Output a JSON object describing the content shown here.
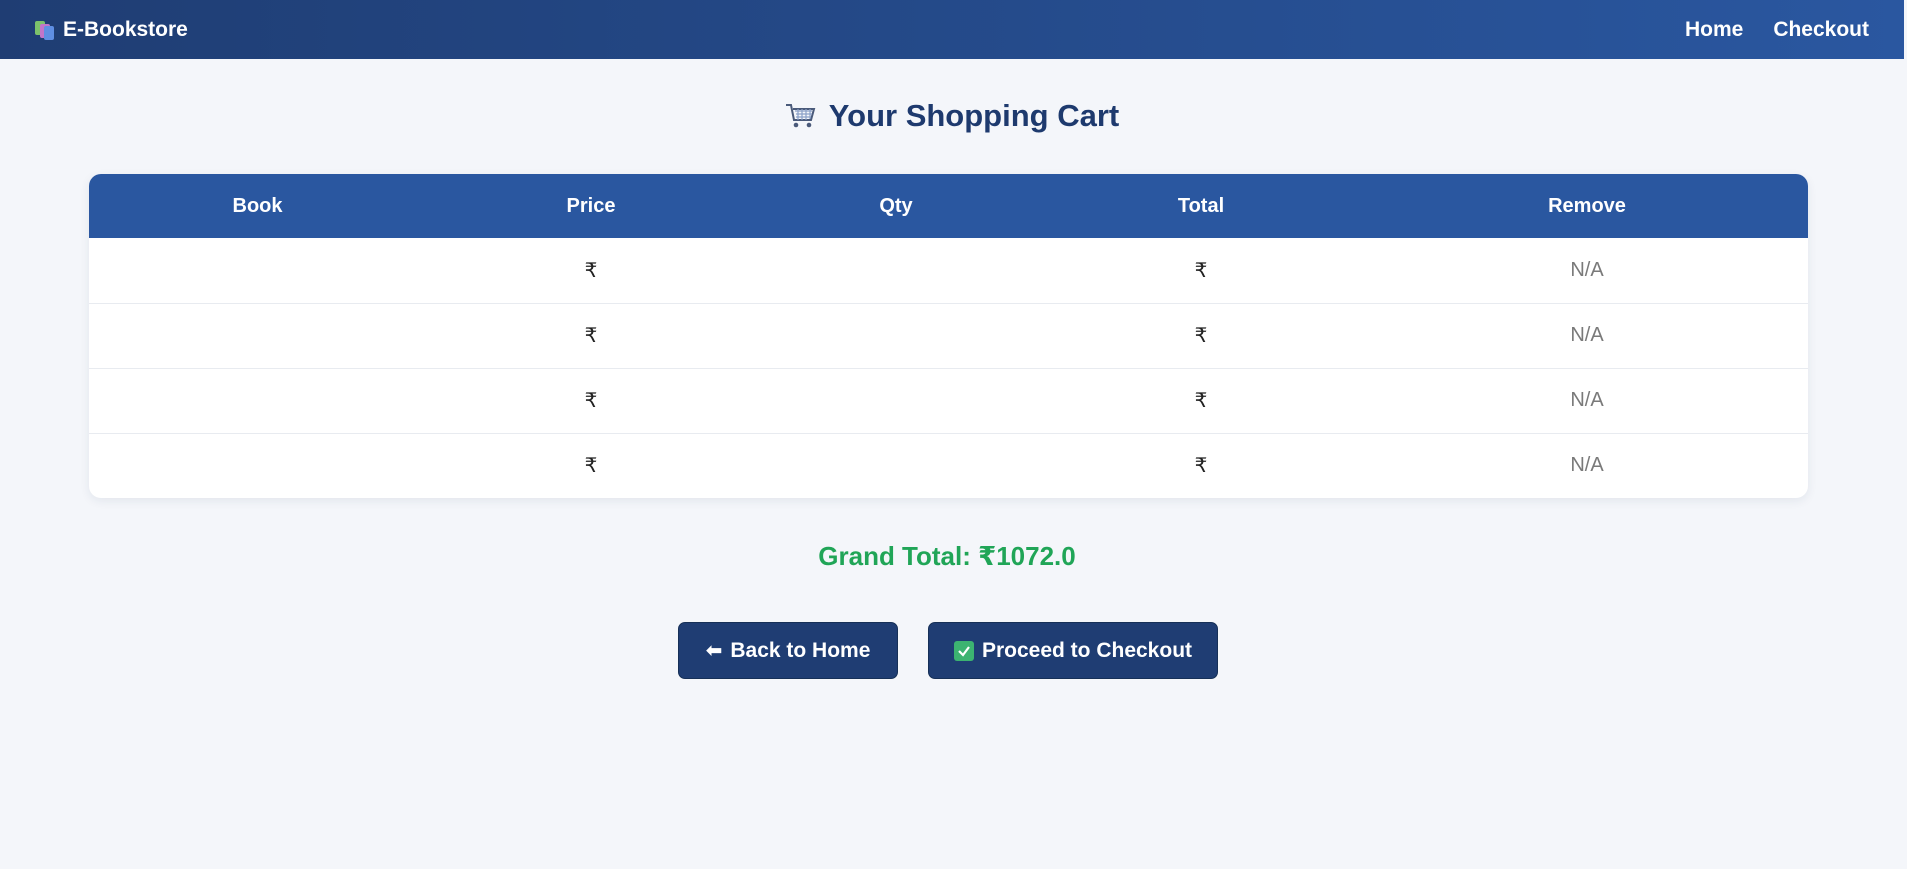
{
  "navbar": {
    "brand": "E-Bookstore",
    "links": [
      "Home",
      "Checkout"
    ]
  },
  "page": {
    "title": "Your Shopping Cart"
  },
  "cart_table": {
    "headers": [
      "Book",
      "Price",
      "Qty",
      "Total",
      "Remove"
    ],
    "rows": [
      {
        "book": "",
        "price": "₹",
        "qty": "",
        "total": "₹",
        "remove": "N/A"
      },
      {
        "book": "",
        "price": "₹",
        "qty": "",
        "total": "₹",
        "remove": "N/A"
      },
      {
        "book": "",
        "price": "₹",
        "qty": "",
        "total": "₹",
        "remove": "N/A"
      },
      {
        "book": "",
        "price": "₹",
        "qty": "",
        "total": "₹",
        "remove": "N/A"
      }
    ]
  },
  "summary": {
    "grand_total": "Grand Total: ₹1072.0"
  },
  "buttons": {
    "back_label": "Back to Home",
    "checkout_label": "Proceed to Checkout"
  },
  "colors": {
    "nav_start": "#1f3d73",
    "nav_end": "#2a57a0",
    "total_green": "#20a557",
    "button_bg": "#1f3d73"
  },
  "icons": {
    "brand": "books-icon",
    "title": "shopping-cart-icon",
    "back": "left-arrow-icon",
    "checkout": "check-mark-icon"
  }
}
